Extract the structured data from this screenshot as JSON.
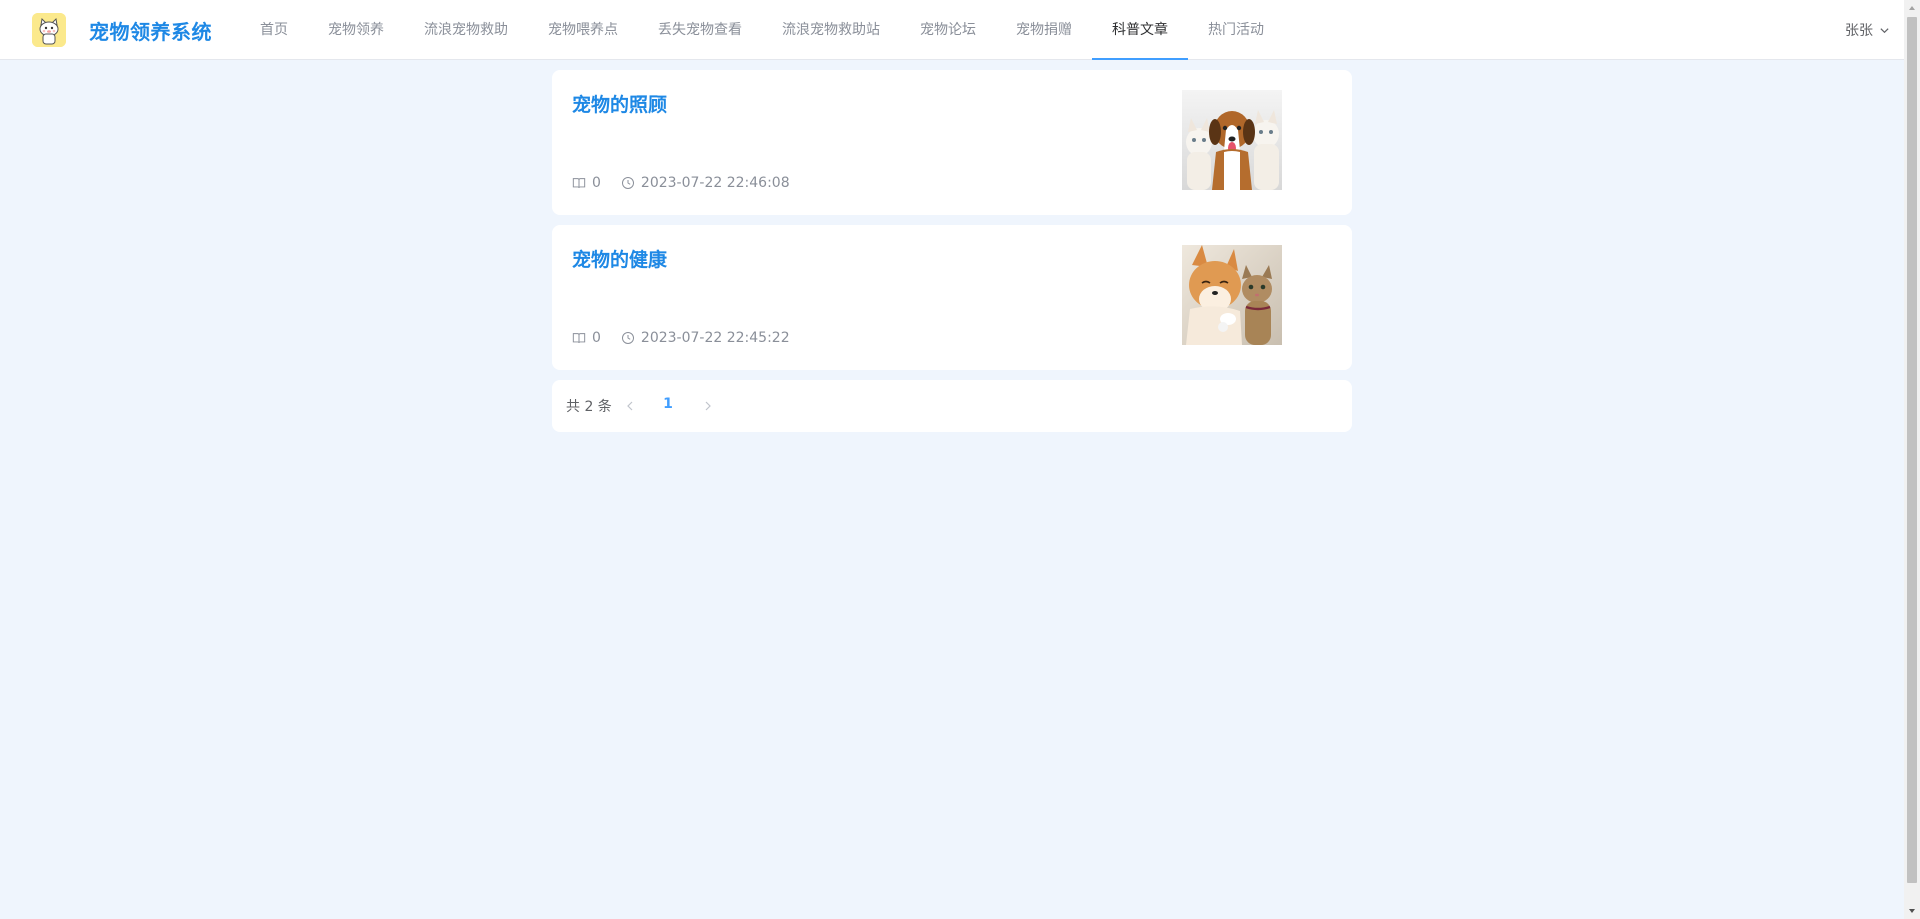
{
  "header": {
    "brand": "宠物领养系统",
    "logo_icon": "cat-logo-icon",
    "nav": [
      {
        "label": "首页",
        "active": false
      },
      {
        "label": "宠物领养",
        "active": false
      },
      {
        "label": "流浪宠物救助",
        "active": false
      },
      {
        "label": "宠物喂养点",
        "active": false
      },
      {
        "label": "丢失宠物查看",
        "active": false
      },
      {
        "label": "流浪宠物救助站",
        "active": false
      },
      {
        "label": "宠物论坛",
        "active": false
      },
      {
        "label": "宠物捐赠",
        "active": false
      },
      {
        "label": "科普文章",
        "active": true
      },
      {
        "label": "热门活动",
        "active": false
      }
    ],
    "user": {
      "name": "张张",
      "icon": "chevron-down-icon"
    }
  },
  "articles": [
    {
      "title": "宠物的照顾",
      "reads": "0",
      "time": "2023-07-22 22:46:08",
      "read_icon": "book-icon",
      "time_icon": "clock-icon",
      "image": "dog-and-two-cats-photo"
    },
    {
      "title": "宠物的健康",
      "reads": "0",
      "time": "2023-07-22 22:45:22",
      "read_icon": "book-icon",
      "time_icon": "clock-icon",
      "image": "shiba-and-cat-photo"
    }
  ],
  "pagination": {
    "total_text": "共 2 条",
    "current_page": "1",
    "prev_icon": "chevron-left-icon",
    "next_icon": "chevron-right-icon"
  },
  "colors": {
    "page_bg": "#eff5fd",
    "brand": "#1e88e5",
    "accent": "#409eff",
    "muted_text": "#8a8f99",
    "logo_bg": "#fbe98c"
  }
}
